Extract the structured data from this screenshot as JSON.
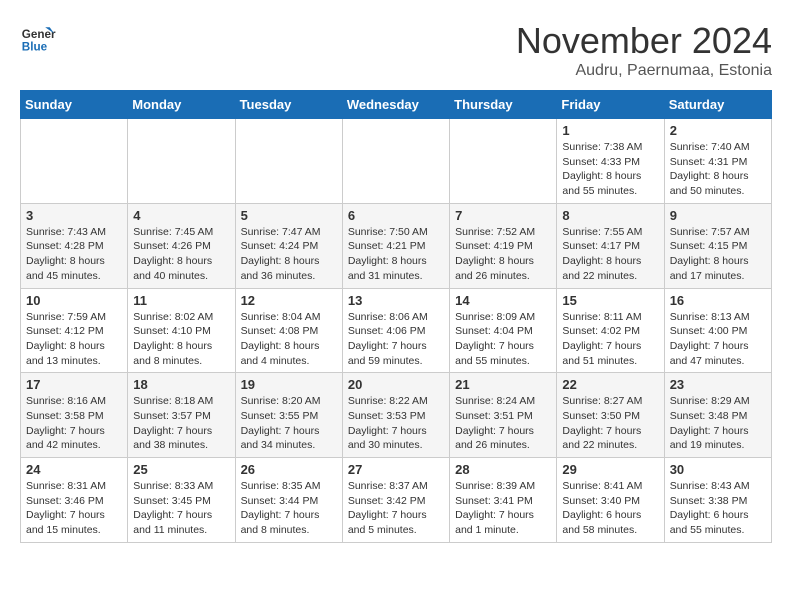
{
  "logo": {
    "line1": "General",
    "line2": "Blue"
  },
  "title": "November 2024",
  "subtitle": "Audru, Paernumaa, Estonia",
  "weekdays": [
    "Sunday",
    "Monday",
    "Tuesday",
    "Wednesday",
    "Thursday",
    "Friday",
    "Saturday"
  ],
  "weeks": [
    [
      {
        "day": "",
        "info": ""
      },
      {
        "day": "",
        "info": ""
      },
      {
        "day": "",
        "info": ""
      },
      {
        "day": "",
        "info": ""
      },
      {
        "day": "",
        "info": ""
      },
      {
        "day": "1",
        "info": "Sunrise: 7:38 AM\nSunset: 4:33 PM\nDaylight: 8 hours\nand 55 minutes."
      },
      {
        "day": "2",
        "info": "Sunrise: 7:40 AM\nSunset: 4:31 PM\nDaylight: 8 hours\nand 50 minutes."
      }
    ],
    [
      {
        "day": "3",
        "info": "Sunrise: 7:43 AM\nSunset: 4:28 PM\nDaylight: 8 hours\nand 45 minutes."
      },
      {
        "day": "4",
        "info": "Sunrise: 7:45 AM\nSunset: 4:26 PM\nDaylight: 8 hours\nand 40 minutes."
      },
      {
        "day": "5",
        "info": "Sunrise: 7:47 AM\nSunset: 4:24 PM\nDaylight: 8 hours\nand 36 minutes."
      },
      {
        "day": "6",
        "info": "Sunrise: 7:50 AM\nSunset: 4:21 PM\nDaylight: 8 hours\nand 31 minutes."
      },
      {
        "day": "7",
        "info": "Sunrise: 7:52 AM\nSunset: 4:19 PM\nDaylight: 8 hours\nand 26 minutes."
      },
      {
        "day": "8",
        "info": "Sunrise: 7:55 AM\nSunset: 4:17 PM\nDaylight: 8 hours\nand 22 minutes."
      },
      {
        "day": "9",
        "info": "Sunrise: 7:57 AM\nSunset: 4:15 PM\nDaylight: 8 hours\nand 17 minutes."
      }
    ],
    [
      {
        "day": "10",
        "info": "Sunrise: 7:59 AM\nSunset: 4:12 PM\nDaylight: 8 hours\nand 13 minutes."
      },
      {
        "day": "11",
        "info": "Sunrise: 8:02 AM\nSunset: 4:10 PM\nDaylight: 8 hours\nand 8 minutes."
      },
      {
        "day": "12",
        "info": "Sunrise: 8:04 AM\nSunset: 4:08 PM\nDaylight: 8 hours\nand 4 minutes."
      },
      {
        "day": "13",
        "info": "Sunrise: 8:06 AM\nSunset: 4:06 PM\nDaylight: 7 hours\nand 59 minutes."
      },
      {
        "day": "14",
        "info": "Sunrise: 8:09 AM\nSunset: 4:04 PM\nDaylight: 7 hours\nand 55 minutes."
      },
      {
        "day": "15",
        "info": "Sunrise: 8:11 AM\nSunset: 4:02 PM\nDaylight: 7 hours\nand 51 minutes."
      },
      {
        "day": "16",
        "info": "Sunrise: 8:13 AM\nSunset: 4:00 PM\nDaylight: 7 hours\nand 47 minutes."
      }
    ],
    [
      {
        "day": "17",
        "info": "Sunrise: 8:16 AM\nSunset: 3:58 PM\nDaylight: 7 hours\nand 42 minutes."
      },
      {
        "day": "18",
        "info": "Sunrise: 8:18 AM\nSunset: 3:57 PM\nDaylight: 7 hours\nand 38 minutes."
      },
      {
        "day": "19",
        "info": "Sunrise: 8:20 AM\nSunset: 3:55 PM\nDaylight: 7 hours\nand 34 minutes."
      },
      {
        "day": "20",
        "info": "Sunrise: 8:22 AM\nSunset: 3:53 PM\nDaylight: 7 hours\nand 30 minutes."
      },
      {
        "day": "21",
        "info": "Sunrise: 8:24 AM\nSunset: 3:51 PM\nDaylight: 7 hours\nand 26 minutes."
      },
      {
        "day": "22",
        "info": "Sunrise: 8:27 AM\nSunset: 3:50 PM\nDaylight: 7 hours\nand 22 minutes."
      },
      {
        "day": "23",
        "info": "Sunrise: 8:29 AM\nSunset: 3:48 PM\nDaylight: 7 hours\nand 19 minutes."
      }
    ],
    [
      {
        "day": "24",
        "info": "Sunrise: 8:31 AM\nSunset: 3:46 PM\nDaylight: 7 hours\nand 15 minutes."
      },
      {
        "day": "25",
        "info": "Sunrise: 8:33 AM\nSunset: 3:45 PM\nDaylight: 7 hours\nand 11 minutes."
      },
      {
        "day": "26",
        "info": "Sunrise: 8:35 AM\nSunset: 3:44 PM\nDaylight: 7 hours\nand 8 minutes."
      },
      {
        "day": "27",
        "info": "Sunrise: 8:37 AM\nSunset: 3:42 PM\nDaylight: 7 hours\nand 5 minutes."
      },
      {
        "day": "28",
        "info": "Sunrise: 8:39 AM\nSunset: 3:41 PM\nDaylight: 7 hours\nand 1 minute."
      },
      {
        "day": "29",
        "info": "Sunrise: 8:41 AM\nSunset: 3:40 PM\nDaylight: 6 hours\nand 58 minutes."
      },
      {
        "day": "30",
        "info": "Sunrise: 8:43 AM\nSunset: 3:38 PM\nDaylight: 6 hours\nand 55 minutes."
      }
    ]
  ]
}
